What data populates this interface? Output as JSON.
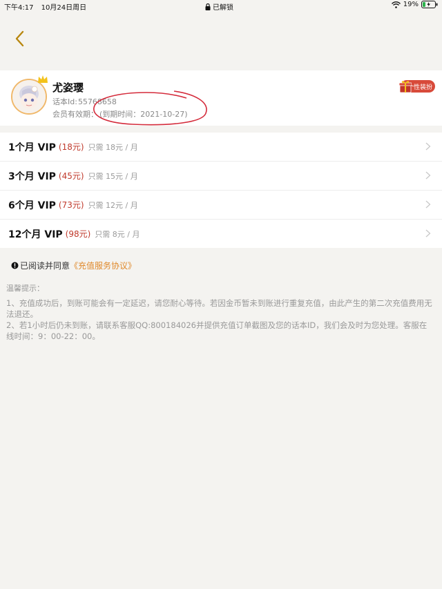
{
  "status_bar": {
    "time": "下午4:17",
    "date": "10月24日周日",
    "lock_text": "已解锁",
    "battery": "19%"
  },
  "profile": {
    "name": "尤姿璎",
    "id_label": "话本Id:",
    "id_value": "55768658",
    "vip_label": "会员有效期：",
    "expiry": "(到期时间：2021-10-27)",
    "gift_label": "个性装扮"
  },
  "vip_options": [
    {
      "name": "1个月 VIP",
      "price": "(18元)",
      "unit": "只需 18元 / 月"
    },
    {
      "name": "3个月 VIP",
      "price": "(45元)",
      "unit": "只需 15元 / 月"
    },
    {
      "name": "6个月 VIP",
      "price": "(73元)",
      "unit": "只需 12元 / 月"
    },
    {
      "name": "12个月 VIP",
      "price": "(98元)",
      "unit": "只需 8元 / 月"
    }
  ],
  "agreement": {
    "prefix": "已阅读并同意",
    "link": "《充值服务协议》"
  },
  "tips": {
    "title": "温馨提示：",
    "line1": "1、充值成功后，到账可能会有一定延迟，请您耐心等待。若因金币暂未到账进行重复充值，由此产生的第二次充值费用无法退还。",
    "line2": "2、若1小时后仍未到账，请联系客服QQ:800184026并提供充值订单截图及您的话本ID，我们会及时为您处理。客服在线时间：9：00-22：00。"
  },
  "colors": {
    "accent": "#e08a2c",
    "price_red": "#c0392b",
    "background": "#f4f3f0"
  }
}
